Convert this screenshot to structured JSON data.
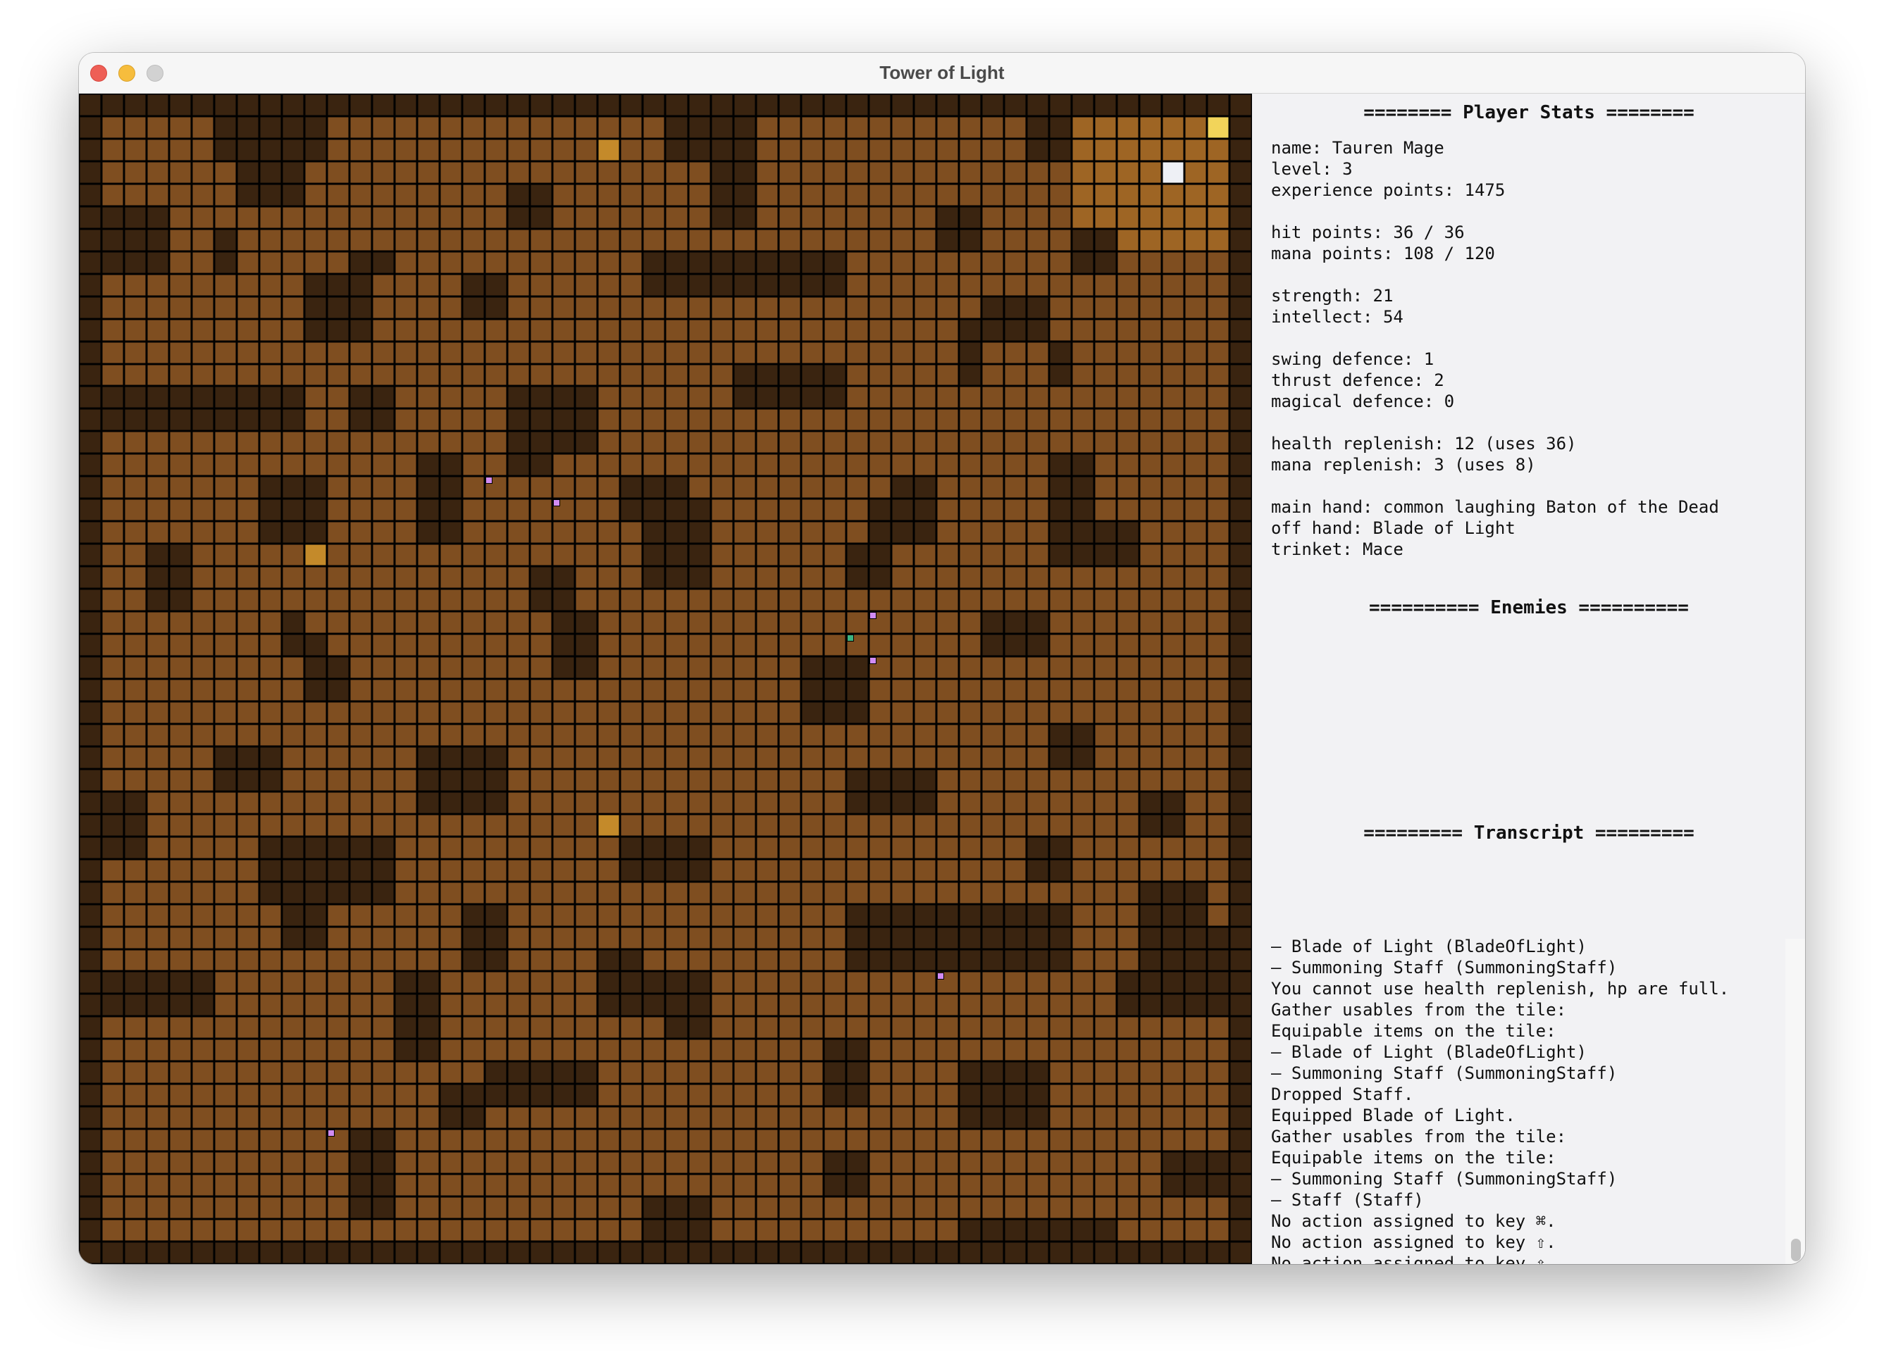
{
  "window": {
    "title": "Tower of Light"
  },
  "map": {
    "wall_color": "#3a2410",
    "floor_color": "#7f4e20",
    "chest_color": "#c48a2a",
    "exit_color": "#f2d45a",
    "player_color": "#eef0f5",
    "enemy_marker_color": "#d28cf4",
    "ally_marker_color": "#3cb482"
  },
  "stats": {
    "title": "======== Player Stats ========",
    "name": "name: Tauren Mage",
    "level": "level: 3",
    "xp": "experience points: 1475",
    "hp": "hit points: 36 / 36",
    "mp": "mana points: 108 / 120",
    "strength": "strength: 21",
    "intellect": "intellect: 54",
    "swing_def": "swing defence: 1",
    "thrust_def": "thrust defence: 2",
    "magic_def": "magical defence: 0",
    "health_rep": "health replenish: 12 (uses 36)",
    "mana_rep": "mana replenish: 3 (uses 8)",
    "main_hand": "main hand: common laughing Baton of the Dead",
    "off_hand": "off hand: Blade of Light",
    "trinket": "trinket: Mace"
  },
  "enemies": {
    "title": "========== Enemies =========="
  },
  "transcript": {
    "title": "========= Transcript =========",
    "lines": [
      "– Blade of Light (BladeOfLight)",
      "– Summoning Staff (SummoningStaff)",
      "You cannot use health replenish, hp are full.",
      "Gather usables from the tile:",
      "Equipable items on the tile:",
      "– Blade of Light (BladeOfLight)",
      "– Summoning Staff (SummoningStaff)",
      "Dropped Staff.",
      "Equipped Blade of Light.",
      "Gather usables from the tile:",
      "Equipable items on the tile:",
      "– Summoning Staff (SummoningStaff)",
      "– Staff (Staff)",
      "No action assigned to key ⌘.",
      "No action assigned to key ⇧.",
      "No action assigned to key ⇧."
    ]
  }
}
